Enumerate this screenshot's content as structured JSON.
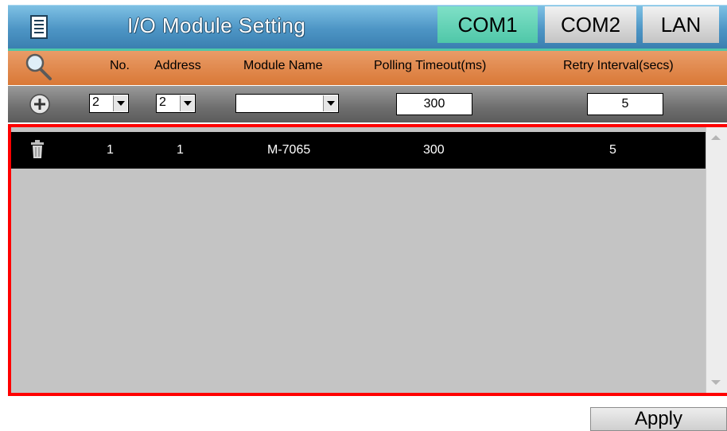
{
  "window": {
    "title": "I/O Module Setting"
  },
  "tabs": [
    {
      "label": "COM1",
      "active": true
    },
    {
      "label": "COM2",
      "active": false
    },
    {
      "label": "LAN",
      "active": false
    }
  ],
  "header": {
    "columns": [
      "No.",
      "Address",
      "Module Name",
      "Polling Timeout(ms)",
      "Retry Interval(secs)"
    ]
  },
  "input_row": {
    "no_value": "2",
    "address_value": "2",
    "module_name_value": "",
    "polling_timeout_value": "300",
    "retry_interval_value": "5"
  },
  "modules": [
    {
      "no": "1",
      "address": "1",
      "module_name": "M-7065",
      "polling_timeout": "300",
      "retry_interval": "5"
    }
  ],
  "footer": {
    "apply_label": "Apply"
  },
  "colors": {
    "title_bar": "#4d95c5",
    "active_tab": "#4fc7a8",
    "header_row": "#d97836",
    "list_border": "#ff0000",
    "selected_row": "#000000"
  },
  "icons": [
    "menu-icon",
    "search-icon",
    "add-icon",
    "trash-icon"
  ]
}
